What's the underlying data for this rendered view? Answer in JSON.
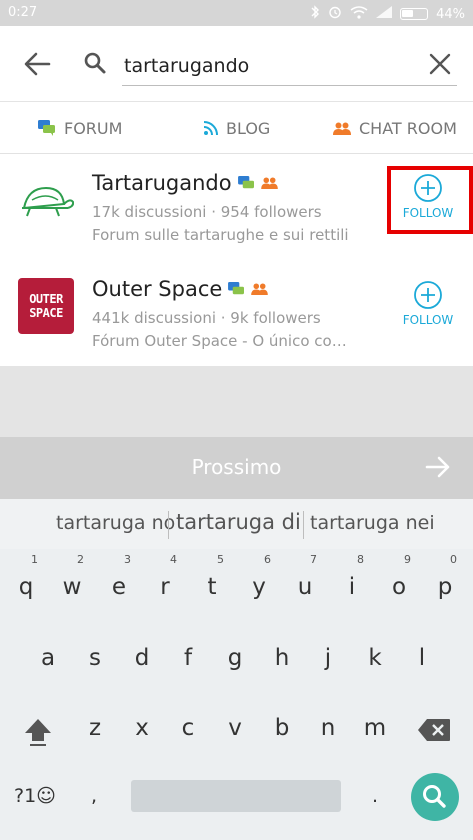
{
  "statusbar": {
    "time": "0:27",
    "battery": "44%"
  },
  "search": {
    "query": "tartarugando",
    "back_icon": "arrow-left-icon",
    "search_icon": "search-icon",
    "clear_icon": "close-icon"
  },
  "tabs": [
    {
      "label": "FORUM",
      "icon": "forum-chat-icon",
      "color": "#2e7dd1"
    },
    {
      "label": "BLOG",
      "icon": "rss-icon",
      "color": "#1ba9d8"
    },
    {
      "label": "CHAT ROOM",
      "icon": "people-icon",
      "color": "#f07b2a"
    }
  ],
  "results": [
    {
      "title": "Tartarugando",
      "meta": "17k discussioni · 954 followers",
      "description": "Forum sulle tartarughe e sui rettili",
      "follow_label": "FOLLOW",
      "icon": "turtle-logo"
    },
    {
      "title": "Outer Space",
      "meta": "441k discussioni · 9k followers",
      "description": "Fórum Outer Space - O único co…",
      "follow_label": "FOLLOW",
      "logo_text": "OUTER SPACE"
    }
  ],
  "next_bar": {
    "label": "Prossimo"
  },
  "suggestions": [
    "tartaruga no",
    "tartaruga di",
    "tartaruga nei"
  ],
  "keyboard": {
    "row1": [
      {
        "key": "q",
        "hint": "1"
      },
      {
        "key": "w",
        "hint": "2"
      },
      {
        "key": "e",
        "hint": "3"
      },
      {
        "key": "r",
        "hint": "4"
      },
      {
        "key": "t",
        "hint": "5"
      },
      {
        "key": "y",
        "hint": "6"
      },
      {
        "key": "u",
        "hint": "7"
      },
      {
        "key": "i",
        "hint": "8"
      },
      {
        "key": "o",
        "hint": "9"
      },
      {
        "key": "p",
        "hint": "0"
      }
    ],
    "row2": [
      "a",
      "s",
      "d",
      "f",
      "g",
      "h",
      "j",
      "k",
      "l"
    ],
    "row3": [
      "z",
      "x",
      "c",
      "v",
      "b",
      "n",
      "m"
    ],
    "symbols_label": "?1☺",
    "comma": ",",
    "period": "."
  },
  "colors": {
    "accent": "#1ba9d8",
    "highlight": "#e60000",
    "search_key": "#3fb5a5"
  }
}
